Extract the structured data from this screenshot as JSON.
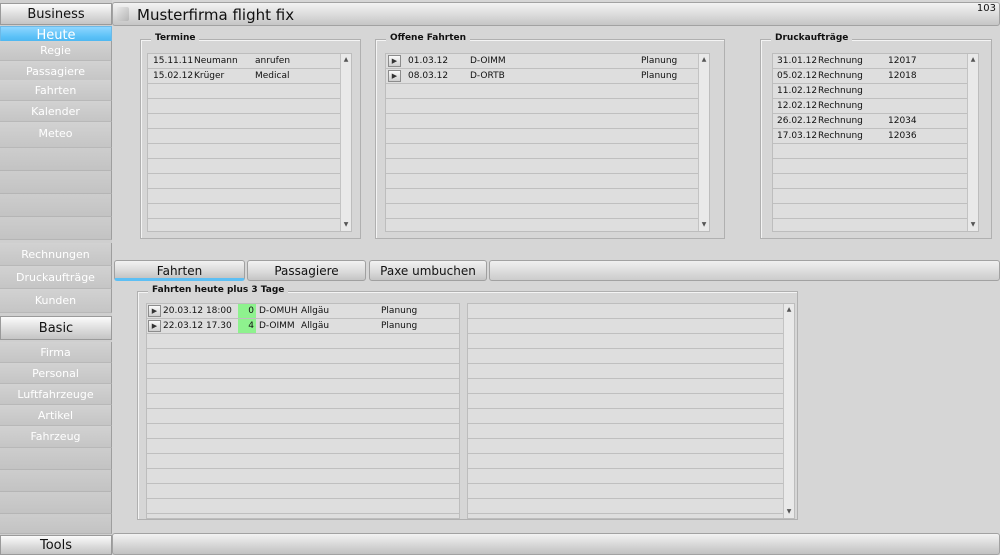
{
  "sidebar": {
    "sections": [
      {
        "label": "Business"
      },
      {
        "label": "Heute"
      },
      {
        "label": "Basic"
      },
      {
        "label": "Tools"
      }
    ],
    "business_items": [
      "Regie",
      "Passagiere",
      "Fahrten",
      "Kalender",
      "Meteo"
    ],
    "business_lower_items": [
      "Rechnungen",
      "Druckaufträge",
      "Kunden"
    ],
    "basic_items": [
      "Firma",
      "Personal",
      "Luftfahrzeuge",
      "Artikel",
      "Fahrzeug"
    ]
  },
  "header": {
    "title": "Musterfirma flight fix",
    "counter": "103"
  },
  "termine": {
    "legend": "Termine",
    "rows": [
      {
        "date": "15.11.11",
        "name": "Neumann",
        "note": "anrufen"
      },
      {
        "date": "15.02.12",
        "name": "Krüger",
        "note": "Medical"
      }
    ]
  },
  "offene_fahrten": {
    "legend": "Offene Fahrten",
    "rows": [
      {
        "date": "01.03.12",
        "aircraft": "D-OIMM",
        "status": "Planung"
      },
      {
        "date": "08.03.12",
        "aircraft": "D-ORTB",
        "status": "Planung"
      }
    ]
  },
  "druckauftraege": {
    "legend": "Druckaufträge",
    "rows": [
      {
        "date": "31.01.12",
        "type": "Rechnung",
        "number": "12017"
      },
      {
        "date": "05.02.12",
        "type": "Rechnung",
        "number": "12018"
      },
      {
        "date": "11.02.12",
        "type": "Rechnung",
        "number": ""
      },
      {
        "date": "12.02.12",
        "type": "Rechnung",
        "number": ""
      },
      {
        "date": "26.02.12",
        "type": "Rechnung",
        "number": "12034"
      },
      {
        "date": "17.03.12",
        "type": "Rechnung",
        "number": "12036"
      }
    ]
  },
  "tabs": [
    {
      "label": "Fahrten",
      "active": true
    },
    {
      "label": "Passagiere",
      "active": false
    },
    {
      "label": "Paxe umbuchen",
      "active": false
    }
  ],
  "fahrten_heute": {
    "legend": "Fahrten heute plus 3 Tage",
    "rows": [
      {
        "datetime": "20.03.12 18:00",
        "pax": "0",
        "aircraft": "D-OMUH",
        "region": "Allgäu",
        "status": "Planung"
      },
      {
        "datetime": "22.03.12 17.30",
        "pax": "4",
        "aircraft": "D-OIMM",
        "region": "Allgäu",
        "status": "Planung"
      }
    ]
  },
  "colors": {
    "active_blue": "#5cc1f7",
    "pax_green": "#8ef28e"
  }
}
